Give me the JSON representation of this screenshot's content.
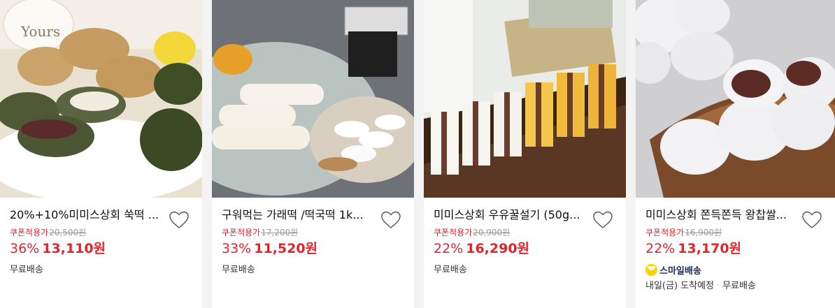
{
  "products": [
    {
      "title": "20%+10%미미스상회 쑥떡 ...",
      "coupon_label": "쿠폰적용가",
      "original_price": "20,500원",
      "discount": "36%",
      "price": "13,110원",
      "shipping": "무료배송",
      "image_icon": "mugwort-rice-cake-image"
    },
    {
      "title": "구워먹는 가래떡 /떡국떡 1k...",
      "coupon_label": "쿠폰적용가",
      "original_price": "17,200원",
      "discount": "33%",
      "price": "11,520원",
      "shipping": "무료배송",
      "image_icon": "garae-tteok-image"
    },
    {
      "title": "미미스상회 우유꿀설기 (50g...",
      "coupon_label": "쿠폰적용가",
      "original_price": "20,900원",
      "discount": "22%",
      "price": "16,290원",
      "shipping": "무료배송",
      "image_icon": "milk-honey-seolgi-image"
    },
    {
      "title": "미미스상회 쫀득쫀득 왕찹쌀...",
      "coupon_label": "쿠폰적용가",
      "original_price": "16,900원",
      "discount": "22%",
      "price": "13,170원",
      "smile_delivery": "스마일배송",
      "delivery_date": "내일(금) 도착예정",
      "shipping": "무료배송",
      "image_icon": "chapssal-tteok-image"
    }
  ],
  "colors": {
    "price_red": "#e2242d",
    "smile_yellow": "#ffd200",
    "smile_navy": "#1b2a55"
  }
}
